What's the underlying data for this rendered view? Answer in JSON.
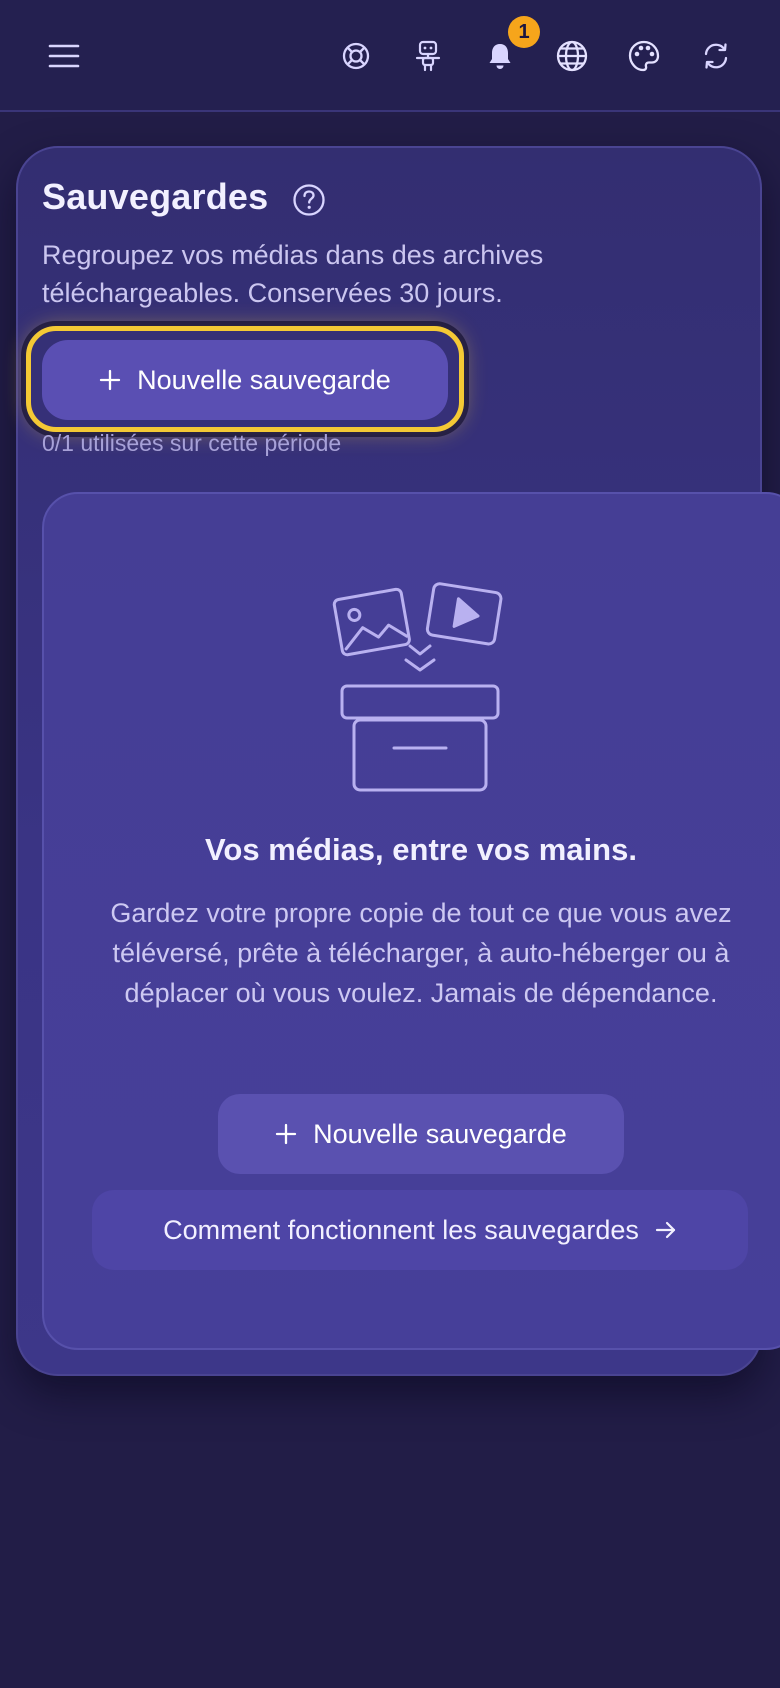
{
  "header": {
    "icons": [
      "menu-icon",
      "lifebuoy-icon",
      "robot-icon",
      "bell-icon",
      "globe-icon",
      "palette-icon",
      "refresh-icon"
    ],
    "notification_count": "1",
    "badge_color": "#f6a51b"
  },
  "backups": {
    "title": "Sauvegardes",
    "description": "Regroupez vos médias dans des archives téléchargeables. Conservées 30 jours.",
    "new_button_label": "Nouvelle sauvegarde",
    "usage": "0/1 utilisées sur cette période",
    "focus_ring_color": "#f4c935"
  },
  "empty_state": {
    "title": "Vos médias, entre vos mains.",
    "text": "Gardez votre propre copie de tout ce que vous avez téléversé, prête à télécharger, à auto-héberger ou à déplacer où vous voulez. Jamais de dépendance.",
    "new_button_label": "Nouvelle sauvegarde",
    "how_it_works_label": "Comment fonctionnent les sauvegardes"
  },
  "colors": {
    "background": "#221d47",
    "card": "#332e71",
    "button": "#5a4fb3"
  }
}
